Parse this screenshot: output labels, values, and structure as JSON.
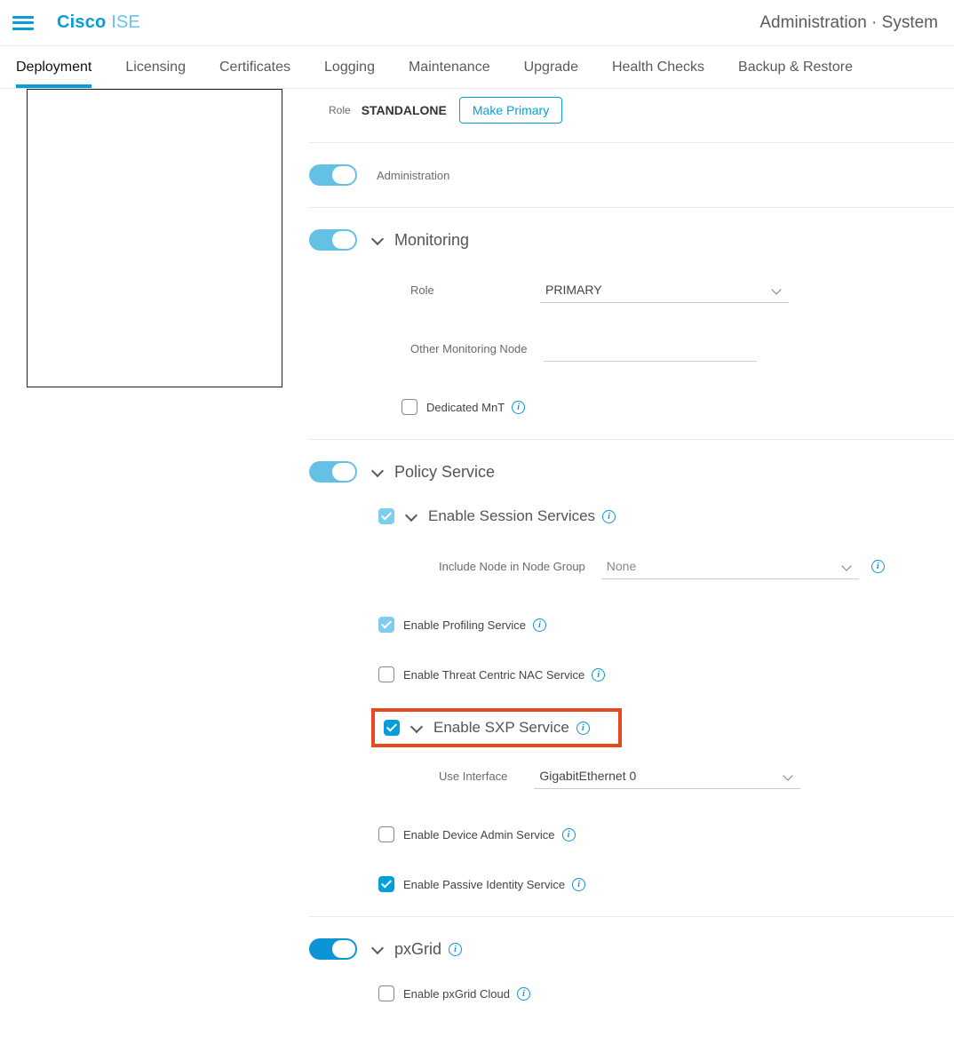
{
  "header": {
    "brand_cisco": "Cisco",
    "brand_ise": "ISE",
    "breadcrumb": "Administration · System"
  },
  "tabs": [
    "Deployment",
    "Licensing",
    "Certificates",
    "Logging",
    "Maintenance",
    "Upgrade",
    "Health Checks",
    "Backup & Restore"
  ],
  "role": {
    "label": "Role",
    "value": "STANDALONE",
    "button": "Make Primary"
  },
  "admin": {
    "label": "Administration"
  },
  "monitoring": {
    "title": "Monitoring",
    "role_label": "Role",
    "role_value": "PRIMARY",
    "other_label": "Other Monitoring Node",
    "dedicated_label": "Dedicated MnT"
  },
  "policy": {
    "title": "Policy Service",
    "session": {
      "title": "Enable Session Services",
      "node_group_label": "Include Node in Node Group",
      "node_group_value": "None"
    },
    "profiling_label": "Enable Profiling Service",
    "threat_label": "Enable Threat Centric NAC Service",
    "sxp": {
      "title": "Enable SXP Service",
      "iface_label": "Use Interface",
      "iface_value": "GigabitEthernet 0"
    },
    "device_admin_label": "Enable Device Admin Service",
    "passive_label": "Enable Passive Identity Service"
  },
  "pxgrid": {
    "title": "pxGrid",
    "cloud_label": "Enable pxGrid Cloud"
  }
}
